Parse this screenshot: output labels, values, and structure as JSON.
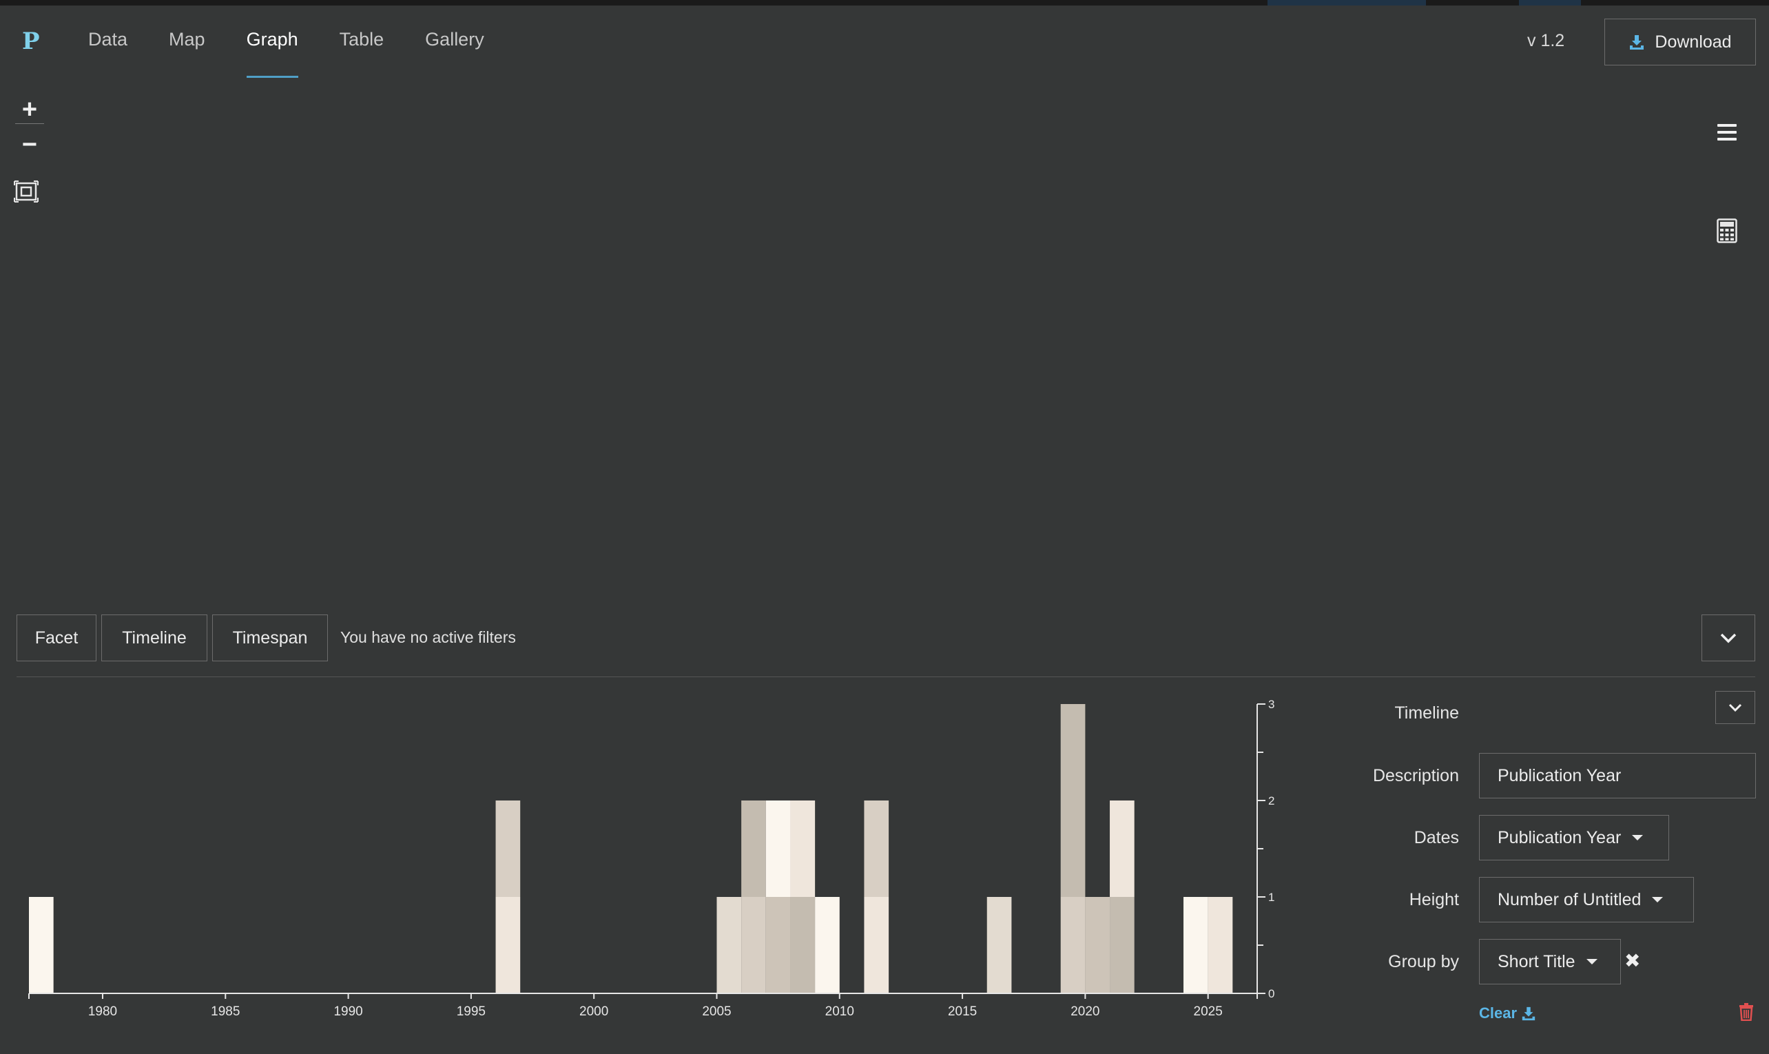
{
  "app": {
    "logo": "P",
    "version": "v 1.2",
    "download_label": "Download"
  },
  "nav": {
    "tabs": [
      "Data",
      "Map",
      "Graph",
      "Table",
      "Gallery"
    ],
    "active": "Graph"
  },
  "map_controls": {
    "zoom_in": "+",
    "zoom_out": "−"
  },
  "filter_bar": {
    "facet_label": "Facet",
    "timeline_label": "Timeline",
    "timespan_label": "Timespan",
    "status_text": "You have no active filters"
  },
  "panel": {
    "title": "Timeline",
    "description_label": "Description",
    "description_value": "Publication Year",
    "dates_label": "Dates",
    "dates_value": "Publication Year",
    "height_label": "Height",
    "height_value": "Number of Untitled",
    "groupby_label": "Group by",
    "groupby_value": "Short Title",
    "clear_label": "Clear"
  },
  "colors": {
    "accent": "#4f9fc7",
    "link": "#5bb6e6",
    "danger": "#e05050",
    "background": "#353737"
  },
  "chart_data": {
    "type": "bar",
    "stacked": true,
    "xlabel": "",
    "ylabel": "",
    "xlim": [
      1977,
      2026
    ],
    "ylim": [
      0,
      3
    ],
    "x_ticks": [
      1980,
      1985,
      1990,
      1995,
      2000,
      2005,
      2010,
      2015,
      2020,
      2025
    ],
    "y_ticks": [
      0,
      1,
      2,
      3
    ],
    "bars": [
      {
        "year": 1977,
        "segments": [
          1
        ]
      },
      {
        "year": 1996,
        "segments": [
          1,
          1
        ]
      },
      {
        "year": 2005,
        "segments": [
          1
        ]
      },
      {
        "year": 2006,
        "segments": [
          1,
          1
        ]
      },
      {
        "year": 2007,
        "segments": [
          1,
          1
        ]
      },
      {
        "year": 2008,
        "segments": [
          1,
          1
        ]
      },
      {
        "year": 2009,
        "segments": [
          1
        ]
      },
      {
        "year": 2011,
        "segments": [
          1,
          1
        ]
      },
      {
        "year": 2016,
        "segments": [
          1
        ]
      },
      {
        "year": 2019,
        "segments": [
          1,
          2
        ]
      },
      {
        "year": 2020,
        "segments": [
          1
        ]
      },
      {
        "year": 2021,
        "segments": [
          1,
          1
        ]
      },
      {
        "year": 2024,
        "segments": [
          1
        ]
      },
      {
        "year": 2025,
        "segments": [
          1
        ]
      }
    ],
    "segment_colors": [
      "#fbf6ee",
      "#efe6dc",
      "#e3dbd0",
      "#d8cfc4",
      "#cdc4b8",
      "#c4bcb0"
    ]
  }
}
